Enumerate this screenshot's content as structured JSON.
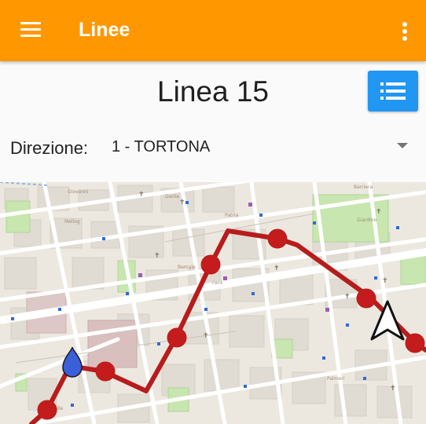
{
  "appbar": {
    "title": "Linee",
    "menu_icon": "menu-icon",
    "more_icon": "more-vert-icon"
  },
  "line": {
    "title": "Linea 15",
    "list_icon": "list-icon"
  },
  "direction": {
    "label": "Direzione:",
    "value": "1 - TORTONA"
  },
  "map": {
    "route_color": "#b71c1c",
    "user_marker_color": "#3b5fd9",
    "compass_icon": "navigation-arrow-icon"
  },
  "colors": {
    "appbar": "#ff9800",
    "list_button": "#2196f3"
  }
}
